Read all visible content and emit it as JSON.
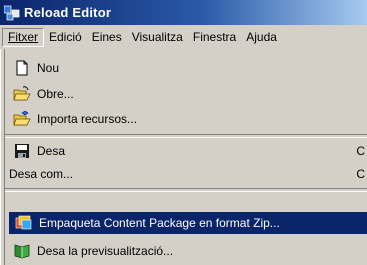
{
  "window": {
    "title": "Reload Editor"
  },
  "menubar": {
    "items": [
      {
        "id": "fitxer",
        "label": "Fitxer"
      },
      {
        "id": "edicio",
        "label": "Edició"
      },
      {
        "id": "eines",
        "label": "Eines"
      },
      {
        "id": "visualitza",
        "label": "Visualitza"
      },
      {
        "id": "finestra",
        "label": "Finestra"
      },
      {
        "id": "ajuda",
        "label": "Ajuda"
      }
    ]
  },
  "menu": {
    "items": [
      {
        "label": "Nou",
        "icon": "new-document-icon"
      },
      {
        "label": "Obre...",
        "icon": "open-folder-icon"
      },
      {
        "label": "Importa recursos...",
        "icon": "import-folder-icon"
      },
      {
        "label": "Desa",
        "icon": "save-disk-icon",
        "shortcut": "C"
      },
      {
        "label": "Desa com...",
        "icon": "",
        "shortcut": "C"
      },
      {
        "label": "Empaqueta Content Package en format Zip...",
        "icon": "package-zip-icon"
      },
      {
        "label": "Desa la previsualització...",
        "icon": "preview-book-icon"
      }
    ]
  },
  "colors": {
    "title_gradient_start": "#0a246a",
    "title_gradient_end": "#a6caf0",
    "menu_bg": "#d4d0c8",
    "highlight": "#0a246a"
  }
}
